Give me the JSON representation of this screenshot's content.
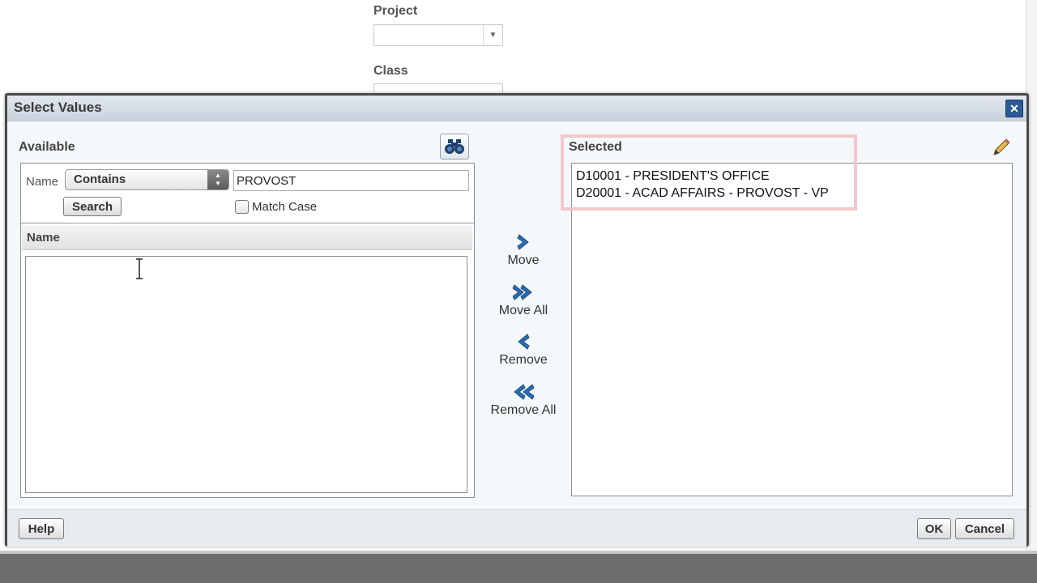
{
  "background": {
    "project_label": "Project",
    "class_label": "Class"
  },
  "dialog": {
    "title": "Select Values",
    "available": {
      "label": "Available",
      "filter_label": "Name",
      "operator": "Contains",
      "search_value": "PROVOST",
      "search_button": "Search",
      "match_case_label": "Match Case",
      "column_header": "Name",
      "items": []
    },
    "shuttle": {
      "move": "Move",
      "move_all": "Move All",
      "remove": "Remove",
      "remove_all": "Remove All"
    },
    "selected": {
      "label": "Selected",
      "items": [
        "D10001 - PRESIDENT'S OFFICE",
        "D20001 - ACAD AFFAIRS - PROVOST - VP"
      ]
    },
    "footer": {
      "help": "Help",
      "ok": "OK",
      "cancel": "Cancel"
    }
  },
  "colors": {
    "highlight": "#f2c6cc",
    "accent": "#2a5a98"
  }
}
